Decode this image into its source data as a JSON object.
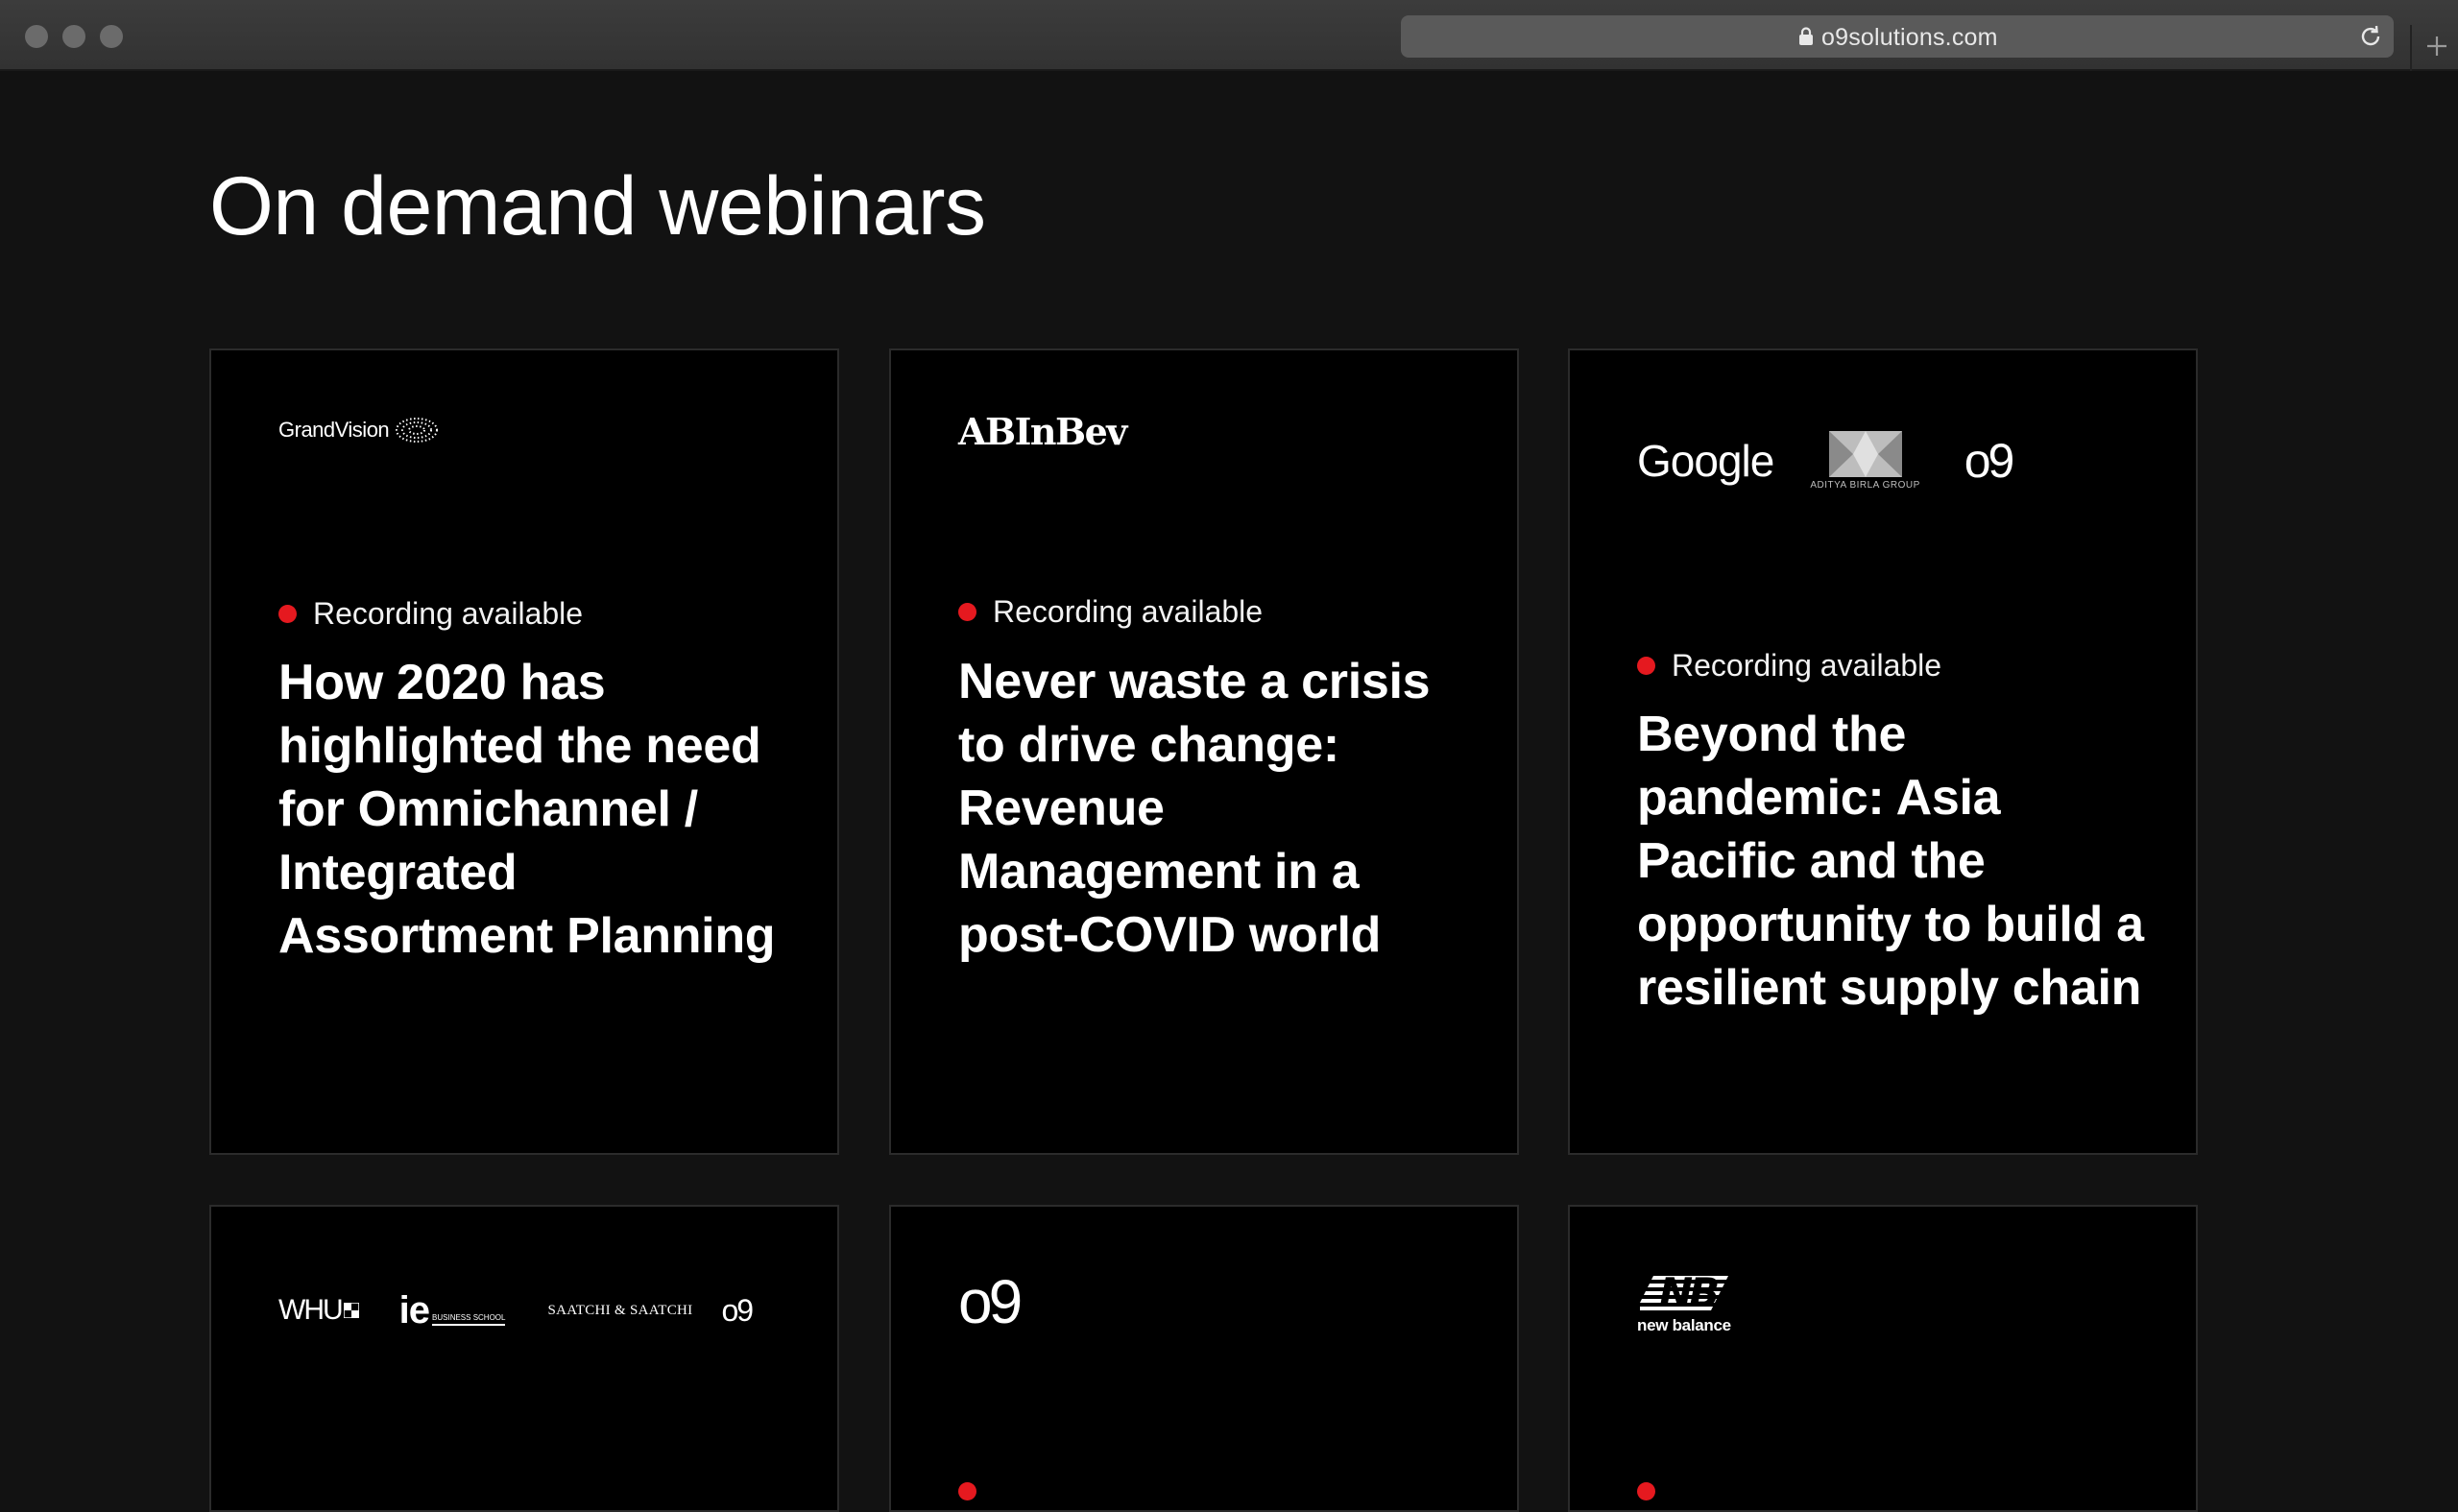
{
  "browser": {
    "url": "o9solutions.com",
    "icons": {
      "lock": "lock-icon",
      "reload": "reload-icon",
      "new_tab": "plus-icon"
    }
  },
  "page": {
    "title": "On demand webinars"
  },
  "colors": {
    "background": "#121212",
    "card": "#000000",
    "recording_dot": "#e5191f"
  },
  "cards": [
    {
      "logos": [
        "GrandVision"
      ],
      "status": "Recording available",
      "title": "How 2020 has highlighted the need for Omnichannel / Integrated Assortment Planning"
    },
    {
      "logos": [
        "ABInBev"
      ],
      "status": "Recording available",
      "title": "Never waste a crisis to drive change: Revenue Management in a post-COVID world"
    },
    {
      "logos": [
        "Google",
        "ADITYA BIRLA GROUP",
        "o9"
      ],
      "status": "Recording available",
      "title": "Beyond the pandemic: Asia Pacific and the opportunity to build a resilient supply chain"
    },
    {
      "logos": [
        "WHU",
        "ie",
        "BUSINESS SCHOOL",
        "SAATCHI & SAATCHI",
        "o9"
      ]
    },
    {
      "logos": [
        "o9"
      ]
    },
    {
      "logos": [
        "new balance"
      ]
    }
  ]
}
